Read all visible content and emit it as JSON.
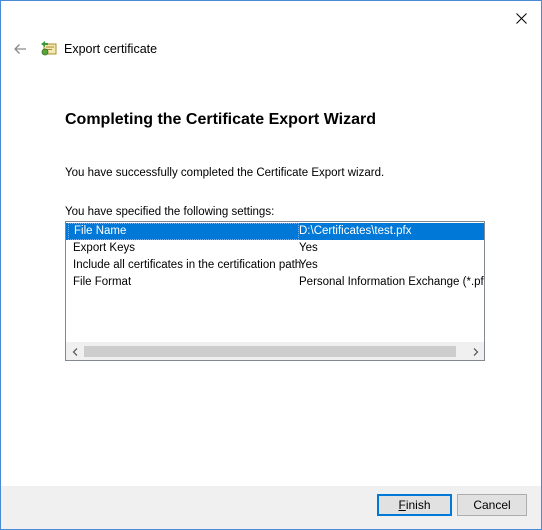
{
  "window": {
    "close_icon": "close-icon"
  },
  "header": {
    "back_icon": "back-arrow-icon",
    "cert_icon": "certificate-icon",
    "title": "Export certificate"
  },
  "main": {
    "title": "Completing the Certificate Export Wizard",
    "success_text": "You have successfully completed the Certificate Export wizard.",
    "settings_label": "You have specified the following settings:"
  },
  "settings_list": {
    "rows": [
      {
        "name": "File Name",
        "value": "D:\\Certificates\\test.pfx",
        "selected": true
      },
      {
        "name": "Export Keys",
        "value": "Yes",
        "selected": false
      },
      {
        "name": "Include all certificates in the certification path",
        "value": "Yes",
        "selected": false
      },
      {
        "name": "File Format",
        "value": "Personal Information Exchange (*.pfx)",
        "selected": false
      }
    ],
    "scroll_left_icon": "chevron-left-icon",
    "scroll_right_icon": "chevron-right-icon"
  },
  "footer": {
    "finish_mnemonic": "F",
    "finish_rest": "inish",
    "cancel_label": "Cancel"
  },
  "colors": {
    "selection": "#0078d7",
    "window_border": "#4a8ad4",
    "footer_bg": "#f0f0f0"
  }
}
